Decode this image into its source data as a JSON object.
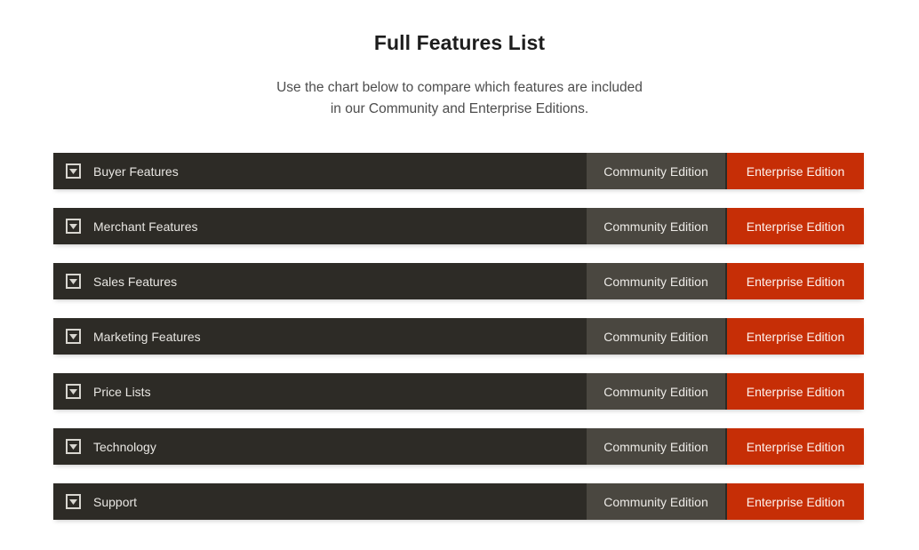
{
  "header": {
    "title": "Full Features List",
    "subtitle_line1": "Use the chart below to compare which features are included",
    "subtitle_line2": "in our Community and Enterprise Editions."
  },
  "columns": {
    "community_label": "Community Edition",
    "enterprise_label": "Enterprise Edition"
  },
  "colors": {
    "page_background": "#ffffff",
    "row_background": "#2d2b26",
    "community_background": "#4a4740",
    "enterprise_background": "#c62e06",
    "row_text": "#e8e6e2",
    "title_text": "#1d1d1d",
    "subtitle_text": "#4d4d4d"
  },
  "icons": {
    "toggle": "caret-down-box-icon"
  },
  "rows": [
    {
      "label": "Buyer Features",
      "toggle_icon": "caret-down-box-icon",
      "community": "Community Edition",
      "enterprise": "Enterprise Edition",
      "expanded": false
    },
    {
      "label": "Merchant Features",
      "toggle_icon": "caret-down-box-icon",
      "community": "Community Edition",
      "enterprise": "Enterprise Edition",
      "expanded": false
    },
    {
      "label": "Sales Features",
      "toggle_icon": "caret-down-box-icon",
      "community": "Community Edition",
      "enterprise": "Enterprise Edition",
      "expanded": false
    },
    {
      "label": "Marketing Features",
      "toggle_icon": "caret-down-box-icon",
      "community": "Community Edition",
      "enterprise": "Enterprise Edition",
      "expanded": false
    },
    {
      "label": "Price Lists",
      "toggle_icon": "caret-down-box-icon",
      "community": "Community Edition",
      "enterprise": "Enterprise Edition",
      "expanded": false
    },
    {
      "label": "Technology",
      "toggle_icon": "caret-down-box-icon",
      "community": "Community Edition",
      "enterprise": "Enterprise Edition",
      "expanded": false
    },
    {
      "label": "Support",
      "toggle_icon": "caret-down-box-icon",
      "community": "Community Edition",
      "enterprise": "Enterprise Edition",
      "expanded": false
    }
  ]
}
